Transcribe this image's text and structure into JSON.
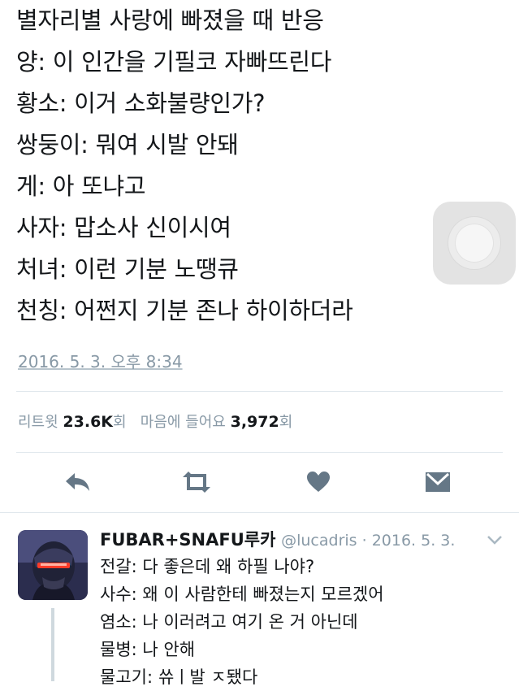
{
  "tweet": {
    "lines": [
      "별자리별 사랑에 빠졌을 때 반응",
      "양: 이 인간을 기필코 자빠뜨린다",
      "황소: 이거 소화불량인가?",
      "쌍둥이: 뭐여 시발 안돼",
      "게: 아 또냐고",
      "사자: 맙소사 신이시여",
      "처녀: 이런 기분 노땡큐",
      "천칭: 어쩐지 기분 존나 하이하더라"
    ],
    "timestamp": "2016. 5. 3. 오후 8:34",
    "stats": {
      "retweet_label": "리트윗",
      "retweet_count": "23.6K",
      "retweet_unit": "회",
      "like_label": "마음에 들어요",
      "like_count": "3,972",
      "like_unit": "회"
    }
  },
  "actions": {
    "reply": "reply-icon",
    "retweet": "retweet-icon",
    "like": "heart-icon",
    "dm": "envelope-icon"
  },
  "reply": {
    "name": "FUBAR+SNAFU루카",
    "meta": "@lucadris · 2016. 5. 3.",
    "lines": [
      "전갈: 다 좋은데 왜 하필 나야?",
      "사수: 왜 이 사람한테 빠졌는지 모르겠어",
      "염소: 나 이러려고 여기 온 거 아닌데",
      "물병: 나 안해",
      "물고기: 쓔ㅣ발 ㅈ됐다"
    ]
  },
  "colors": {
    "text": "#14171a",
    "muted": "#8899a6",
    "icon": "#657786",
    "divider": "#e1e8ed"
  }
}
